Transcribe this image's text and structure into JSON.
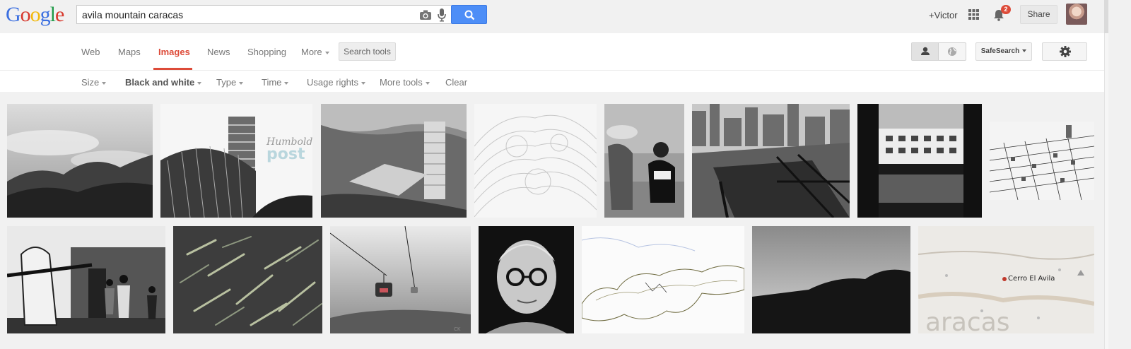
{
  "logo": {
    "letters": [
      "G",
      "o",
      "o",
      "g",
      "l",
      "e"
    ]
  },
  "search": {
    "query": "avila mountain caracas"
  },
  "header": {
    "user_link": "+Victor",
    "notification_count": "2",
    "share_label": "Share"
  },
  "nav": {
    "tabs": [
      {
        "label": "Web"
      },
      {
        "label": "Maps"
      },
      {
        "label": "Images",
        "active": true
      },
      {
        "label": "News"
      },
      {
        "label": "Shopping"
      },
      {
        "label": "More"
      }
    ],
    "search_tools_label": "Search tools",
    "safesearch_label": "SafeSearch"
  },
  "filters": {
    "items": [
      {
        "label": "Size"
      },
      {
        "label": "Black and white",
        "selected": true
      },
      {
        "label": "Type"
      },
      {
        "label": "Time"
      },
      {
        "label": "Usage rights"
      },
      {
        "label": "More tools"
      }
    ],
    "clear_label": "Clear"
  },
  "image_texts": {
    "humboldt_line1": "Humboldt",
    "humboldt_line2": "post",
    "map_label_cerro": "Cerro El Avila",
    "map_label_caracas": "aracas",
    "photo_credit": "CK"
  },
  "colors": {
    "accent_red": "#dd4b39",
    "search_blue": "#4d8ef7",
    "page_bg": "#f1f1f1"
  }
}
